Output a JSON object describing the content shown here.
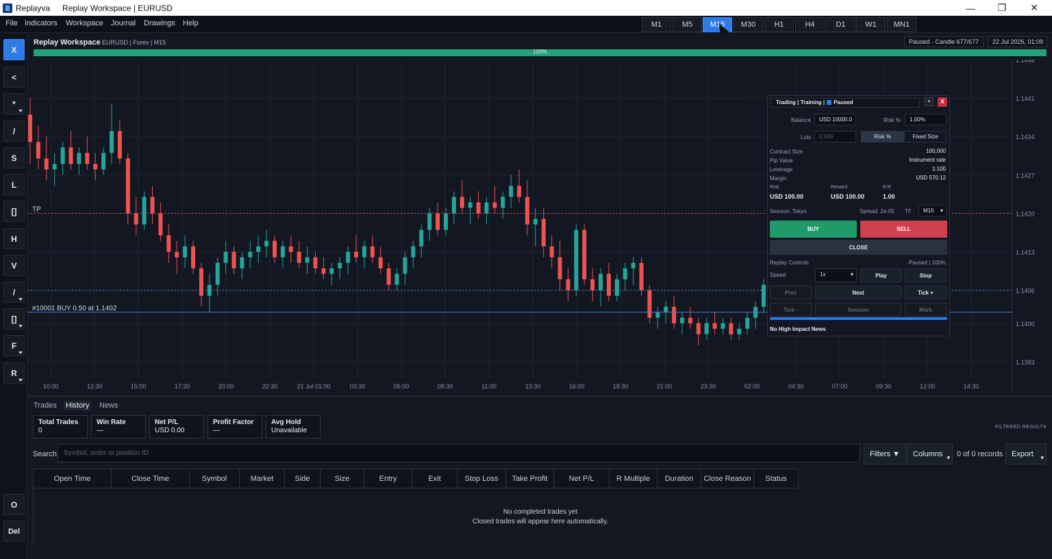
{
  "titlebar": {
    "app_name": "Replayva",
    "document_title": "Replay Workspace | EURUSD",
    "minimize": "—",
    "maximize": "❐",
    "close": "✕"
  },
  "menu": [
    "File",
    "Indicators",
    "Workspace",
    "Journal",
    "Drawings",
    "Help"
  ],
  "timeframes": [
    "M1",
    "M5",
    "M15",
    "M30",
    "H1",
    "H4",
    "D1",
    "W1",
    "MN1"
  ],
  "active_timeframe": "M15",
  "left_tools": [
    {
      "label": "X",
      "icon": "close-icon"
    },
    {
      "label": "<",
      "icon": "collapse-icon"
    },
    {
      "label": "*",
      "icon": "crosshair-icon"
    },
    {
      "label": "/",
      "icon": "trendline-icon"
    },
    {
      "label": "S",
      "icon": "support-icon"
    },
    {
      "label": "L",
      "icon": "line-icon"
    },
    {
      "label": "[]",
      "icon": "rectangle-icon"
    },
    {
      "label": "H",
      "icon": "horizontal-line-icon"
    },
    {
      "label": "V",
      "icon": "vertical-line-icon"
    },
    {
      "label": "/",
      "icon": "ray-icon"
    },
    {
      "label": "[]",
      "icon": "box-icon"
    },
    {
      "label": "F",
      "icon": "fibonacci-icon"
    },
    {
      "label": "R",
      "icon": "ruler-icon"
    },
    {
      "label": "O",
      "icon": "circle-icon"
    },
    {
      "label": "Del",
      "icon": "delete-icon"
    }
  ],
  "workspace": {
    "title": "Replay Workspace",
    "subtitle": "EURUSD | Forex | M15",
    "status": "Paused · Candle 677/677",
    "datetime": "22 Jul 2026, 01:09",
    "progress_pct": 100,
    "progress_label": "100%"
  },
  "chart_data": {
    "type": "candlestick",
    "symbol": "EURUSD",
    "ylim": [
      1.139,
      1.1448
    ],
    "y_ticks": [
      "1.1448",
      "1.1441",
      "1.1434",
      "1.1427",
      "1.1420",
      "1.1413",
      "1.1406",
      "1.1400",
      "1.1393"
    ],
    "x_ticks": [
      "10:00",
      "12:30",
      "15:00",
      "17:30",
      "20:00",
      "22:30",
      "21 Jul 01:00",
      "03:30",
      "06:00",
      "08:30",
      "11:00",
      "13:30",
      "16:00",
      "18:30",
      "21:00",
      "23:30",
      "02:00",
      "04:30",
      "07:00",
      "09:30",
      "12:00",
      "14:30"
    ],
    "lines": [
      {
        "label": "TP",
        "price": 1.142,
        "color": "#e05a66",
        "style": "dotted"
      },
      {
        "label": "",
        "price": 1.1406,
        "color": "#5b86c9",
        "style": "dotted"
      },
      {
        "label": "#10001 BUY 0.50 at 1.1402",
        "price": 1.1402,
        "color": "#4a7fd0",
        "style": "solid"
      }
    ],
    "up_color": "#26a69a",
    "down_color": "#ef5350",
    "candles": [
      [
        1.1438,
        1.1441,
        1.1429,
        1.1433
      ],
      [
        1.1433,
        1.1436,
        1.1428,
        1.143
      ],
      [
        1.143,
        1.1434,
        1.1426,
        1.1428
      ],
      [
        1.1428,
        1.1431,
        1.1425,
        1.1429
      ],
      [
        1.1429,
        1.1433,
        1.1427,
        1.1432
      ],
      [
        1.1432,
        1.1435,
        1.1428,
        1.1429
      ],
      [
        1.1429,
        1.1432,
        1.1427,
        1.1431
      ],
      [
        1.1431,
        1.1434,
        1.1428,
        1.1429
      ],
      [
        1.1429,
        1.1431,
        1.1426,
        1.1428
      ],
      [
        1.1428,
        1.1432,
        1.1427,
        1.1431
      ],
      [
        1.1431,
        1.144,
        1.1429,
        1.1435
      ],
      [
        1.1435,
        1.1437,
        1.1429,
        1.143
      ],
      [
        1.143,
        1.1431,
        1.1418,
        1.142
      ],
      [
        1.142,
        1.1423,
        1.1416,
        1.1418
      ],
      [
        1.1418,
        1.1424,
        1.1417,
        1.1423
      ],
      [
        1.1423,
        1.1425,
        1.1418,
        1.142
      ],
      [
        1.142,
        1.1422,
        1.1415,
        1.1416
      ],
      [
        1.1416,
        1.1418,
        1.1411,
        1.1413
      ],
      [
        1.1413,
        1.1415,
        1.1409,
        1.1412
      ],
      [
        1.1412,
        1.1416,
        1.141,
        1.1414
      ],
      [
        1.1414,
        1.1415,
        1.1409,
        1.141
      ],
      [
        1.141,
        1.1411,
        1.1403,
        1.1405
      ],
      [
        1.1405,
        1.1409,
        1.1402,
        1.1407
      ],
      [
        1.1407,
        1.1412,
        1.1405,
        1.1411
      ],
      [
        1.1411,
        1.1415,
        1.1409,
        1.1413
      ],
      [
        1.1413,
        1.1414,
        1.1409,
        1.141
      ],
      [
        1.141,
        1.1413,
        1.1408,
        1.1412
      ],
      [
        1.1412,
        1.1415,
        1.141,
        1.1413
      ],
      [
        1.1413,
        1.1416,
        1.1411,
        1.1414
      ],
      [
        1.1414,
        1.1417,
        1.1412,
        1.1415
      ],
      [
        1.1415,
        1.1416,
        1.1411,
        1.1412
      ],
      [
        1.1412,
        1.1415,
        1.141,
        1.1414
      ],
      [
        1.1414,
        1.1416,
        1.1411,
        1.1413
      ],
      [
        1.1413,
        1.1415,
        1.141,
        1.1411
      ],
      [
        1.1411,
        1.1414,
        1.1409,
        1.1412
      ],
      [
        1.1412,
        1.1413,
        1.1409,
        1.141
      ],
      [
        1.141,
        1.1412,
        1.1408,
        1.1409
      ],
      [
        1.1409,
        1.1411,
        1.1407,
        1.141
      ],
      [
        1.141,
        1.1412,
        1.1408,
        1.1411
      ],
      [
        1.1411,
        1.1414,
        1.1409,
        1.1413
      ],
      [
        1.1413,
        1.1416,
        1.1411,
        1.1412
      ],
      [
        1.1412,
        1.1415,
        1.141,
        1.1414
      ],
      [
        1.1414,
        1.1416,
        1.1411,
        1.1412
      ],
      [
        1.1412,
        1.1414,
        1.1409,
        1.141
      ],
      [
        1.141,
        1.1411,
        1.1406,
        1.1407
      ],
      [
        1.1407,
        1.141,
        1.1406,
        1.1409
      ],
      [
        1.1409,
        1.1413,
        1.1407,
        1.1412
      ],
      [
        1.1412,
        1.1415,
        1.141,
        1.1414
      ],
      [
        1.1414,
        1.1418,
        1.1412,
        1.1417
      ],
      [
        1.1417,
        1.1421,
        1.1415,
        1.142
      ],
      [
        1.142,
        1.1422,
        1.1416,
        1.1417
      ],
      [
        1.1417,
        1.1421,
        1.1416,
        1.142
      ],
      [
        1.142,
        1.1424,
        1.1418,
        1.1423
      ],
      [
        1.1423,
        1.1426,
        1.142,
        1.1421
      ],
      [
        1.1421,
        1.1423,
        1.1418,
        1.1422
      ],
      [
        1.1422,
        1.1424,
        1.1419,
        1.142
      ],
      [
        1.142,
        1.1423,
        1.1418,
        1.1422
      ],
      [
        1.1422,
        1.1425,
        1.142,
        1.1421
      ],
      [
        1.1421,
        1.1424,
        1.1419,
        1.1423
      ],
      [
        1.1423,
        1.1427,
        1.1421,
        1.1425
      ],
      [
        1.1425,
        1.1428,
        1.1422,
        1.1423
      ],
      [
        1.1423,
        1.1426,
        1.1416,
        1.1418
      ],
      [
        1.1418,
        1.1421,
        1.1414,
        1.1419
      ],
      [
        1.1419,
        1.1421,
        1.1412,
        1.1414
      ],
      [
        1.1414,
        1.1416,
        1.141,
        1.1412
      ],
      [
        1.1412,
        1.1415,
        1.1406,
        1.1408
      ],
      [
        1.1408,
        1.141,
        1.1404,
        1.1406
      ],
      [
        1.1406,
        1.1418,
        1.1405,
        1.1417
      ],
      [
        1.1417,
        1.1418,
        1.1407,
        1.1408
      ],
      [
        1.1408,
        1.141,
        1.1404,
        1.1406
      ],
      [
        1.1406,
        1.141,
        1.1403,
        1.1409
      ],
      [
        1.1409,
        1.1411,
        1.1404,
        1.1405
      ],
      [
        1.1405,
        1.1409,
        1.1404,
        1.1408
      ],
      [
        1.1408,
        1.1411,
        1.1406,
        1.141
      ],
      [
        1.141,
        1.1412,
        1.1407,
        1.1411
      ],
      [
        1.1411,
        1.1412,
        1.1405,
        1.1406
      ],
      [
        1.1406,
        1.1407,
        1.14,
        1.1401
      ],
      [
        1.1401,
        1.1403,
        1.1399,
        1.1402
      ],
      [
        1.1402,
        1.1404,
        1.14,
        1.1403
      ],
      [
        1.1403,
        1.1405,
        1.1399,
        1.14
      ],
      [
        1.14,
        1.1402,
        1.1398,
        1.1401
      ],
      [
        1.1401,
        1.1403,
        1.1399,
        1.14
      ],
      [
        1.14,
        1.1401,
        1.1396,
        1.1398
      ],
      [
        1.1398,
        1.1401,
        1.1397,
        1.14
      ],
      [
        1.14,
        1.1402,
        1.1398,
        1.1399
      ],
      [
        1.1399,
        1.1401,
        1.1398,
        1.14
      ],
      [
        1.14,
        1.1401,
        1.1397,
        1.1398
      ],
      [
        1.1398,
        1.14,
        1.1397,
        1.1399
      ],
      [
        1.1399,
        1.1402,
        1.1398,
        1.1401
      ],
      [
        1.1401,
        1.1404,
        1.1399,
        1.1403
      ],
      [
        1.1403,
        1.1408,
        1.1402,
        1.1407
      ],
      [
        1.1407,
        1.1408,
        1.1402,
        1.1404
      ]
    ]
  },
  "trading_panel": {
    "header": "Trading | Training |",
    "header_status": "Paused",
    "min_label": "▾",
    "close_label": "X",
    "balance_label": "Balance",
    "balance_value": "USD 10000.0",
    "risk_label": "Risk %",
    "risk_value": "1.00%",
    "lots_label": "Lots",
    "lots_placeholder": "0.500",
    "mode_risk": "Risk %",
    "mode_fixed": "Fixed Size",
    "contract_size_label": "Contract Size",
    "contract_size_value": "100,000",
    "pip_value_label": "Pip Value",
    "pip_value_value": "Instrument rate",
    "leverage_label": "Leverage",
    "leverage_value": "1:100",
    "margin_label": "Margin",
    "margin_value": "USD 570.12",
    "risk_amt_label": "Risk",
    "risk_amt_value": "USD 100.00",
    "reward_label": "Reward",
    "reward_value": "USD 100.00",
    "rr_label": "R:R",
    "rr_value": "1.00",
    "session_label": "Session: Tokyo",
    "spread_label": "Spread: 2e-05",
    "tf_label": "TF",
    "tf_value": "M15",
    "buy": "BUY",
    "sell": "SELL",
    "close": "CLOSE",
    "replay_label": "Replay Controls",
    "replay_status": "Paused | 100%",
    "speed_label": "Speed",
    "speed_value": "1x",
    "play": "Play",
    "stop": "Stop",
    "prev": "Prev",
    "next": "Next",
    "tick_plus": "Tick +",
    "tick_minus": "Tick -",
    "session_btn": "Session",
    "mark": "Mark",
    "news": "No High Impact News"
  },
  "bottom": {
    "tabs": [
      "Trades",
      "History",
      "News"
    ],
    "active_tab": "History",
    "kpis": [
      {
        "key": "Total Trades",
        "value": "0"
      },
      {
        "key": "Win Rate",
        "value": "—"
      },
      {
        "key": "Net P/L",
        "value": "USD 0.00"
      },
      {
        "key": "Profit Factor",
        "value": "—"
      },
      {
        "key": "Avg Hold",
        "value": "Unavailable"
      }
    ],
    "filtered_label": "FILTERED RESULTS",
    "search_label": "Search",
    "search_placeholder": "Symbol, order or position ID",
    "filters_btn": "Filters ▼",
    "columns_btn": "Columns",
    "records": "0 of 0 records",
    "export_btn": "Export",
    "columns": [
      "Open Time",
      "Close Time",
      "Symbol",
      "Market",
      "Side",
      "Size",
      "Entry",
      "Exit",
      "Stop Loss",
      "Take Profit",
      "Net P/L",
      "R Multiple",
      "Duration",
      "Close Reason",
      "Status"
    ],
    "empty_title": "No completed trades yet",
    "empty_sub": "Closed trades will appear here automatically."
  }
}
